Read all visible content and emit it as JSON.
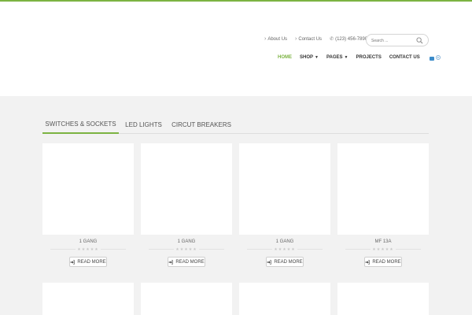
{
  "header": {
    "top_links": [
      {
        "label": "About Us",
        "icon": "chevron-right-icon"
      },
      {
        "label": "Contact Us",
        "icon": "chevron-right-icon"
      },
      {
        "label": "(123) 456-7890",
        "icon": "phone-icon"
      }
    ],
    "search": {
      "placeholder": "Search ..."
    },
    "nav": [
      {
        "label": "HOME",
        "active": true,
        "dropdown": false
      },
      {
        "label": "SHOP",
        "active": false,
        "dropdown": true
      },
      {
        "label": "PAGES",
        "active": false,
        "dropdown": true
      },
      {
        "label": "PROJECTS",
        "active": false,
        "dropdown": false
      },
      {
        "label": "CONTACT US",
        "active": false,
        "dropdown": false
      }
    ],
    "cart": {
      "icon": "shopping-bag-icon",
      "count": "0"
    }
  },
  "tabs": [
    {
      "label": "SWITCHES & SOCKETS",
      "active": true
    },
    {
      "label": "LED LIGHTS",
      "active": false
    },
    {
      "label": "CIRCUT BREAKERS",
      "active": false
    }
  ],
  "products": [
    {
      "name": "1 GANG",
      "rating": 0,
      "button": "READ MORE"
    },
    {
      "name": "1 GANG",
      "rating": 0,
      "button": "READ MORE"
    },
    {
      "name": "1 GANG",
      "rating": 0,
      "button": "READ MORE"
    },
    {
      "name": "MF 13A",
      "rating": 0,
      "button": "READ MORE"
    }
  ],
  "colors": {
    "accent": "#7cb342",
    "cart": "#3b8bc9",
    "background": "#f2f2f2"
  }
}
